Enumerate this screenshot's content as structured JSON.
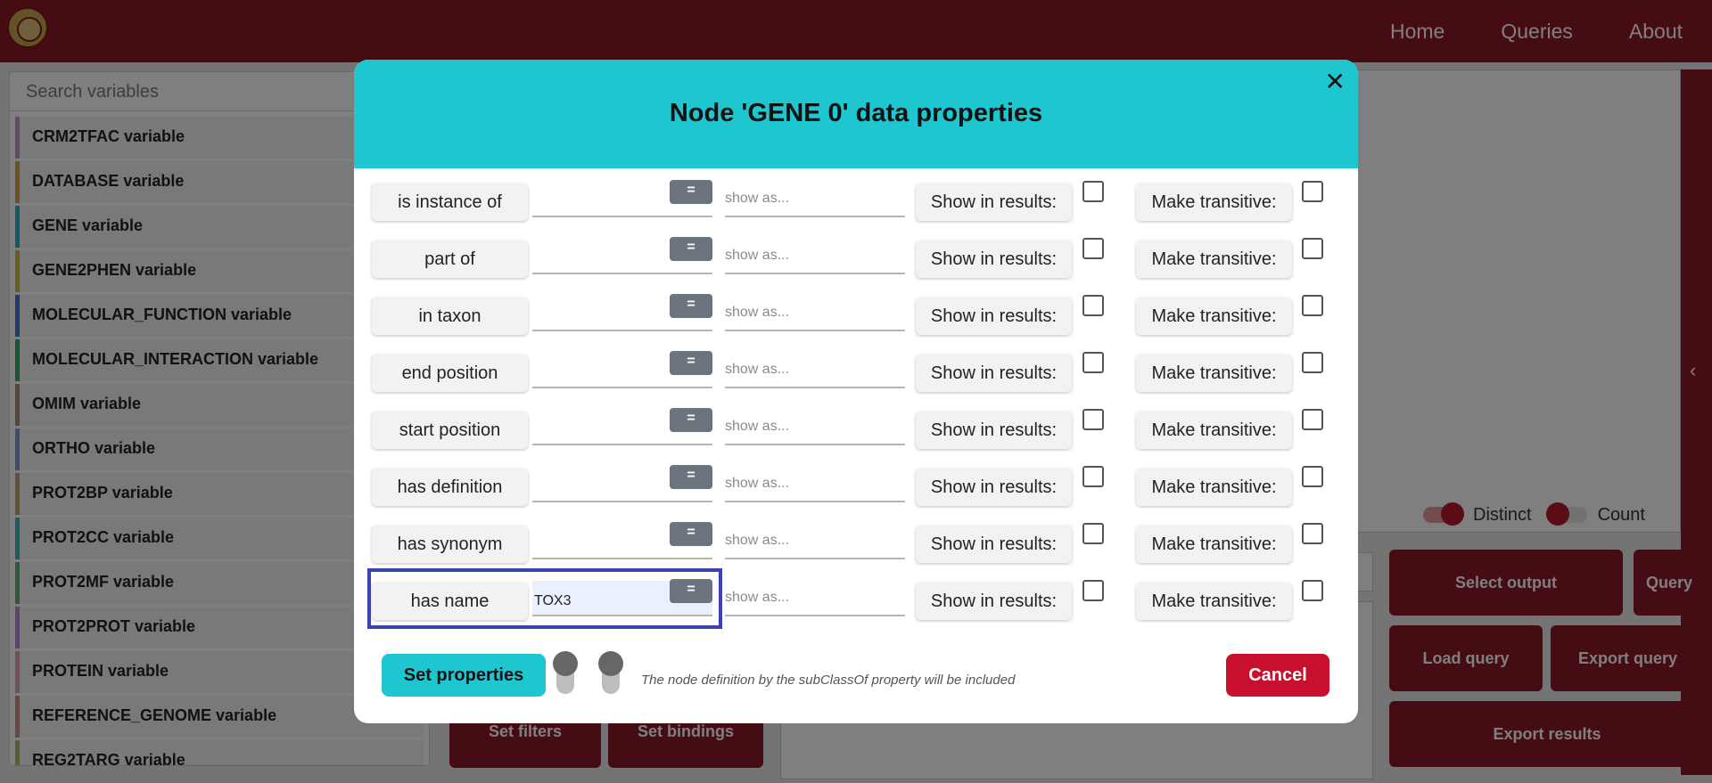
{
  "navbar": {
    "links": [
      "Home",
      "Queries",
      "About"
    ]
  },
  "sidebar": {
    "search_placeholder": "Search variables",
    "items": [
      {
        "label": "CRM2TFAC variable",
        "color": "#c98fd6"
      },
      {
        "label": "DATABASE variable",
        "color": "#d9a53a"
      },
      {
        "label": "GENE variable",
        "color": "#1eb7c0"
      },
      {
        "label": "GENE2PHEN variable",
        "color": "#d6b73a"
      },
      {
        "label": "MOLECULAR_FUNCTION variable",
        "color": "#3a7bd6"
      },
      {
        "label": "MOLECULAR_INTERACTION variable",
        "color": "#2fae6a"
      },
      {
        "label": "OMIM variable",
        "color": "#b8886a"
      },
      {
        "label": "ORTHO variable",
        "color": "#7e9bd6"
      },
      {
        "label": "PROT2BP variable",
        "color": "#c2a36a"
      },
      {
        "label": "PROT2CC variable",
        "color": "#3ab8c0"
      },
      {
        "label": "PROT2MF variable",
        "color": "#5fae7a"
      },
      {
        "label": "PROT2PROT variable",
        "color": "#b38ad6"
      },
      {
        "label": "PROTEIN variable",
        "color": "#e0a3a8"
      },
      {
        "label": "REFERENCE_GENOME variable",
        "color": "#d98a8f"
      },
      {
        "label": "REG2TARG variable",
        "color": "#a0c060"
      }
    ]
  },
  "toggles": {
    "distinct_label": "Distinct",
    "count_label": "Count"
  },
  "actions": {
    "select_output": "Select output",
    "query": "Query",
    "load_query": "Load query",
    "export_query": "Export query",
    "export_results": "Export results",
    "set_filters": "Set filters",
    "set_bindings": "Set bindings"
  },
  "modal": {
    "title": "Node 'GENE 0' data properties",
    "close_glyph": "✕",
    "eq_label": "=",
    "show_as_placeholder": "show as...",
    "show_in_results_label": "Show in results:",
    "make_transitive_label": "Make transitive:",
    "rows": [
      {
        "label": "is instance of",
        "value": ""
      },
      {
        "label": "part of",
        "value": ""
      },
      {
        "label": "in taxon",
        "value": ""
      },
      {
        "label": "end position",
        "value": ""
      },
      {
        "label": "start position",
        "value": ""
      },
      {
        "label": "has definition",
        "value": ""
      },
      {
        "label": "has synonym",
        "value": ""
      },
      {
        "label": "has name",
        "value": "TOX3"
      }
    ],
    "set_properties_label": "Set properties",
    "note": "The node definition by the subClassOf property will be included",
    "cancel_label": "Cancel"
  }
}
